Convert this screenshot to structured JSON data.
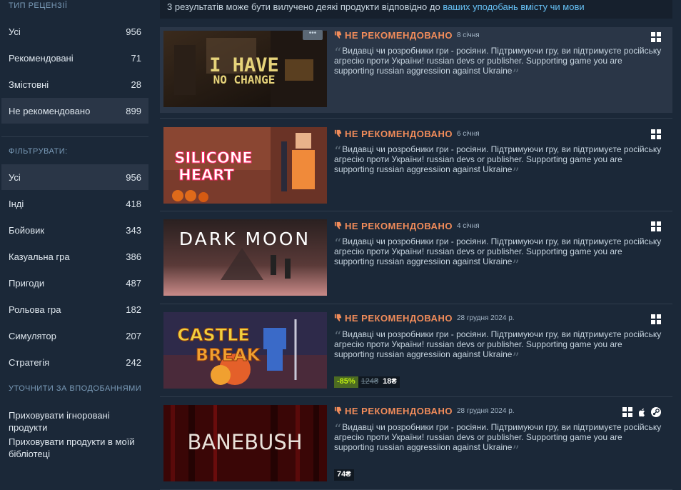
{
  "sidebar": {
    "review_type_title": "ТИП РЕЦЕНЗІЇ",
    "review_types": [
      {
        "label": "Усі",
        "count": "956"
      },
      {
        "label": "Рекомендовані",
        "count": "71"
      },
      {
        "label": "Змістовні",
        "count": "28"
      },
      {
        "label": "Не рекомендовано",
        "count": "899"
      }
    ],
    "filter_title": "ФІЛЬТРУВАТИ:",
    "filters": [
      {
        "label": "Усі",
        "count": "956"
      },
      {
        "label": "Інді",
        "count": "418"
      },
      {
        "label": "Бойовик",
        "count": "343"
      },
      {
        "label": "Казуальна гра",
        "count": "386"
      },
      {
        "label": "Пригоди",
        "count": "487"
      },
      {
        "label": "Рольова гра",
        "count": "182"
      },
      {
        "label": "Симулятор",
        "count": "207"
      },
      {
        "label": "Стратегія",
        "count": "242"
      }
    ],
    "refine_title": "УТОЧНИТИ ЗА ВПОДОБАННЯМИ",
    "refine_options": [
      "Приховувати ігноровані продукти",
      "Приховувати продукти в моїй бібліотеці"
    ]
  },
  "notice": {
    "text": "3 результатів може бути вилучено деякі продукти відповідно до ",
    "link": "ваших уподобань вмісту чи мови"
  },
  "reviews": [
    {
      "game": "I HAVE NO CHANGE",
      "capsule_line1": "I HAVE",
      "capsule_line2": "NO CHANGE",
      "verdict": "НЕ РЕКОМЕНДОВАНО",
      "date": "8 січня",
      "text": "Видавці чи розробники гри - росіяни. Підтримуючи гру, ви підтримуєте російську агресію проти України! russian devs or publisher. Supporting game you are supporting russian aggressiion against Ukraine",
      "more_label": "•••"
    },
    {
      "game": "SILICONE HEART",
      "capsule_line1": "SILICONE",
      "capsule_line2": "HEART",
      "verdict": "НЕ РЕКОМЕНДОВАНО",
      "date": "6 січня",
      "text": "Видавці чи розробники гри - росіяни. Підтримуючи гру, ви підтримуєте російську агресію проти України! russian devs or publisher. Supporting game you are supporting russian aggressiion against Ukraine"
    },
    {
      "game": "DARK MOON",
      "capsule_line1": "DARK MOON",
      "verdict": "НЕ РЕКОМЕНДОВАНО",
      "date": "4 січня",
      "text": "Видавці чи розробники гри - росіяни. Підтримуючи гру, ви підтримуєте російську агресію проти України! russian devs or publisher. Supporting game you are supporting russian aggressiion against Ukraine"
    },
    {
      "game": "CASTLE BREAK",
      "capsule_line1": "CASTLE",
      "capsule_line2": "BREAK",
      "verdict": "НЕ РЕКОМЕНДОВАНО",
      "date": "28 грудня 2024 р.",
      "text": "Видавці чи розробники гри - росіяни. Підтримуючи гру, ви підтримуєте російську агресію проти України! russian devs or publisher. Supporting game you are supporting russian aggressiion against Ukraine",
      "discount": "-85%",
      "old_price": "124₴",
      "price": "18₴"
    },
    {
      "game": "BANEBUSH",
      "capsule_line1": "BANEBUSH",
      "verdict": "НЕ РЕКОМЕНДОВАНО",
      "date": "28 грудня 2024 р.",
      "text": "Видавці чи розробники гри - росіяни. Підтримуючи гру, ви підтримуєте російську агресію проти України! russian devs or publisher. Supporting game you are supporting russian aggressiion against Ukraine",
      "price": "74₴"
    }
  ],
  "colors": {
    "background": "#1b2838",
    "negative": "#f28c5a",
    "link": "#66c0f4",
    "discount_bg": "#4c6b22",
    "discount_text": "#beee11"
  },
  "icons": [
    "windows-icon",
    "apple-icon",
    "steam-icon",
    "thumbs-down-icon"
  ]
}
